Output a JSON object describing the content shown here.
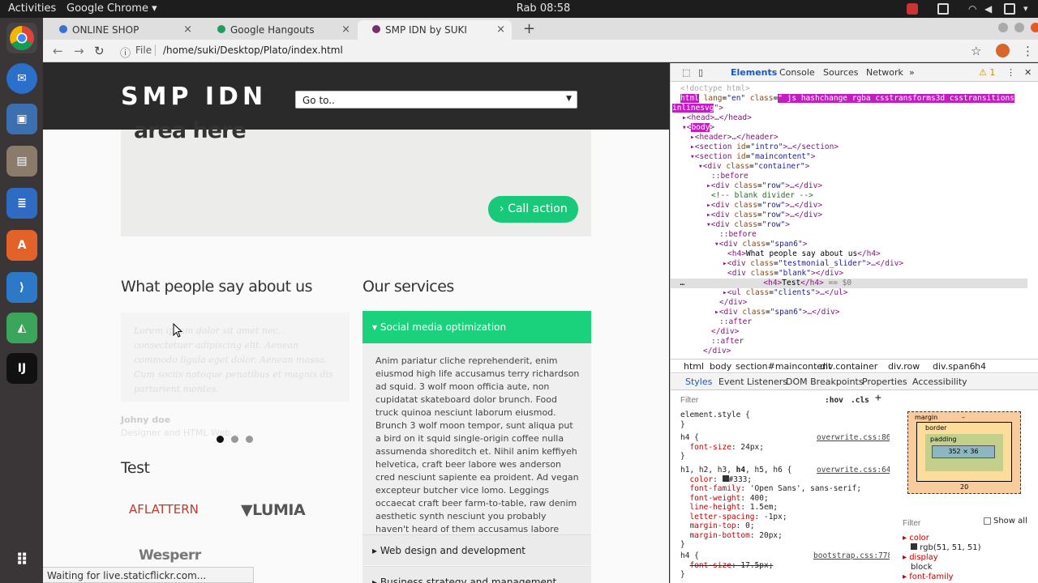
{
  "topbar": {
    "activities": "Activities",
    "app_name": "Google Chrome ▾",
    "clock": "Rab 08:58"
  },
  "tabs": [
    {
      "title": "ONLINE SHOP",
      "close": "×"
    },
    {
      "title": "Google Hangouts",
      "close": "×"
    },
    {
      "title": "SMP IDN by SUKI",
      "close": "×"
    }
  ],
  "new_tab": "+",
  "omnibox": {
    "scheme_label": "File",
    "url": "/home/suki/Desktop/Plato/index.html"
  },
  "site": {
    "logo": "SMP IDN",
    "goto_select": "Go to..",
    "cta_text": "area here",
    "cta_button": "Call action",
    "testimonials_title": "What people say about us",
    "testimonial_text": "Lorem ipsum dolor sit amet nec, consectetuer adipiscing elit. Aenean commodo ligula eget dolor. Aenean massa. Cum sociis natoque penatibus et magnis dis parturient montes.",
    "testimonial_author": "Johny doe",
    "testimonial_role": "Designer and HTML Web...",
    "services_title": "Our services",
    "accordion_open": "Social media optimization",
    "accordion_text": "Anim pariatur cliche reprehenderit, enim eiusmod high life accusamus terry richardson ad squid. 3 wolf moon officia aute, non cupidatat skateboard dolor brunch. Food truck quinoa nesciunt laborum eiusmod. Brunch 3 wolf moon tempor, sunt aliqua put a bird on it squid single-origin coffee nulla assumenda shoreditch et. Nihil anim keffiyeh helvetica, craft beer labore wes anderson cred nesciunt sapiente ea proident. Ad vegan excepteur butcher vice lomo. Leggings occaecat craft beer farm-to-table, raw denim aesthetic synth nesciunt you probably haven't heard of them accusamus labore sustainable VHS.",
    "accordion_item2": "Web design and development",
    "accordion_item3": "Business strategy and management",
    "test_title": "Test",
    "clients": [
      "AFLATTERN",
      "LUMIA",
      "Wesperr"
    ]
  },
  "status_text": "Waiting for live.staticflickr.com...",
  "devtools": {
    "tabs": [
      "Elements",
      "Console",
      "Sources",
      "Network",
      "»"
    ],
    "warnings": "⚠ 1",
    "breadcrumbs": [
      "html",
      "body",
      "section#maincontent",
      "div.container",
      "div.row",
      "div.span6",
      "h4"
    ],
    "styles_tabs": [
      "Styles",
      "Event Listeners",
      "DOM Breakpoints",
      "Properties",
      "Accessibility"
    ],
    "filter_placeholder": "Filter",
    "hov": ":hov",
    "cls": ".cls",
    "computed_filter": "Filter",
    "show_all": "Show all",
    "box_model": {
      "margin": "margin",
      "border": "border",
      "padding": "padding",
      "content": "352 × 36",
      "margin_bottom": "20",
      "dash": "–"
    },
    "computed": [
      {
        "prop": "color",
        "value": "rgb(51, 51, 51)"
      },
      {
        "prop": "display",
        "value": "block"
      },
      {
        "prop": "font-family",
        "value": ""
      }
    ]
  },
  "colors": {
    "accent_green": "#19d27b",
    "header_dark": "#2a2a2a"
  }
}
